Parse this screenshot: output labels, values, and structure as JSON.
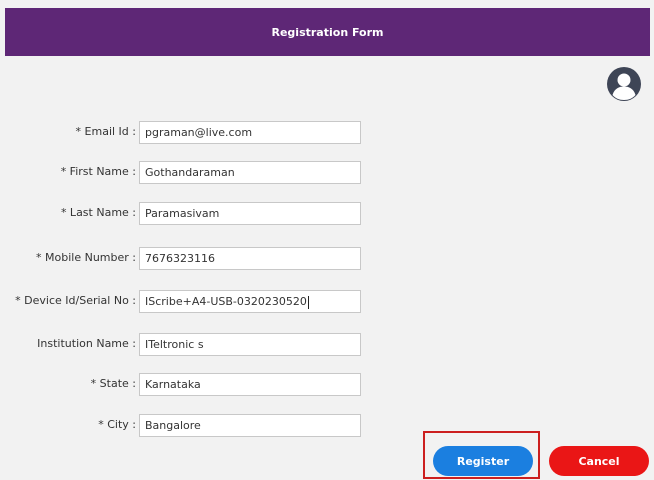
{
  "window": {
    "title": "Registration Form"
  },
  "colors": {
    "title_bar": "#5e2776",
    "register": "#1b7fe0",
    "cancel": "#ea1616",
    "highlight": "#cc1f1f"
  },
  "form": {
    "email": {
      "label": "* Email Id :",
      "value": "pgraman@live.com"
    },
    "first_name": {
      "label": "* First Name :",
      "value": "Gothandaraman"
    },
    "last_name": {
      "label": "* Last Name :",
      "value": "Paramasivam"
    },
    "mobile": {
      "label": "* Mobile Number :",
      "value": "7676323116"
    },
    "device_id": {
      "label": "* Device Id/Serial No :",
      "value": "IScribe+A4-USB-0320230520"
    },
    "institution": {
      "label": "Institution Name :",
      "value": "ITeltronic s"
    },
    "state": {
      "label": "* State :",
      "value": "Karnataka"
    },
    "city": {
      "label": "* City :",
      "value": "Bangalore"
    }
  },
  "buttons": {
    "register": "Register",
    "cancel": "Cancel"
  },
  "icons": {
    "avatar": "user-avatar-icon"
  }
}
